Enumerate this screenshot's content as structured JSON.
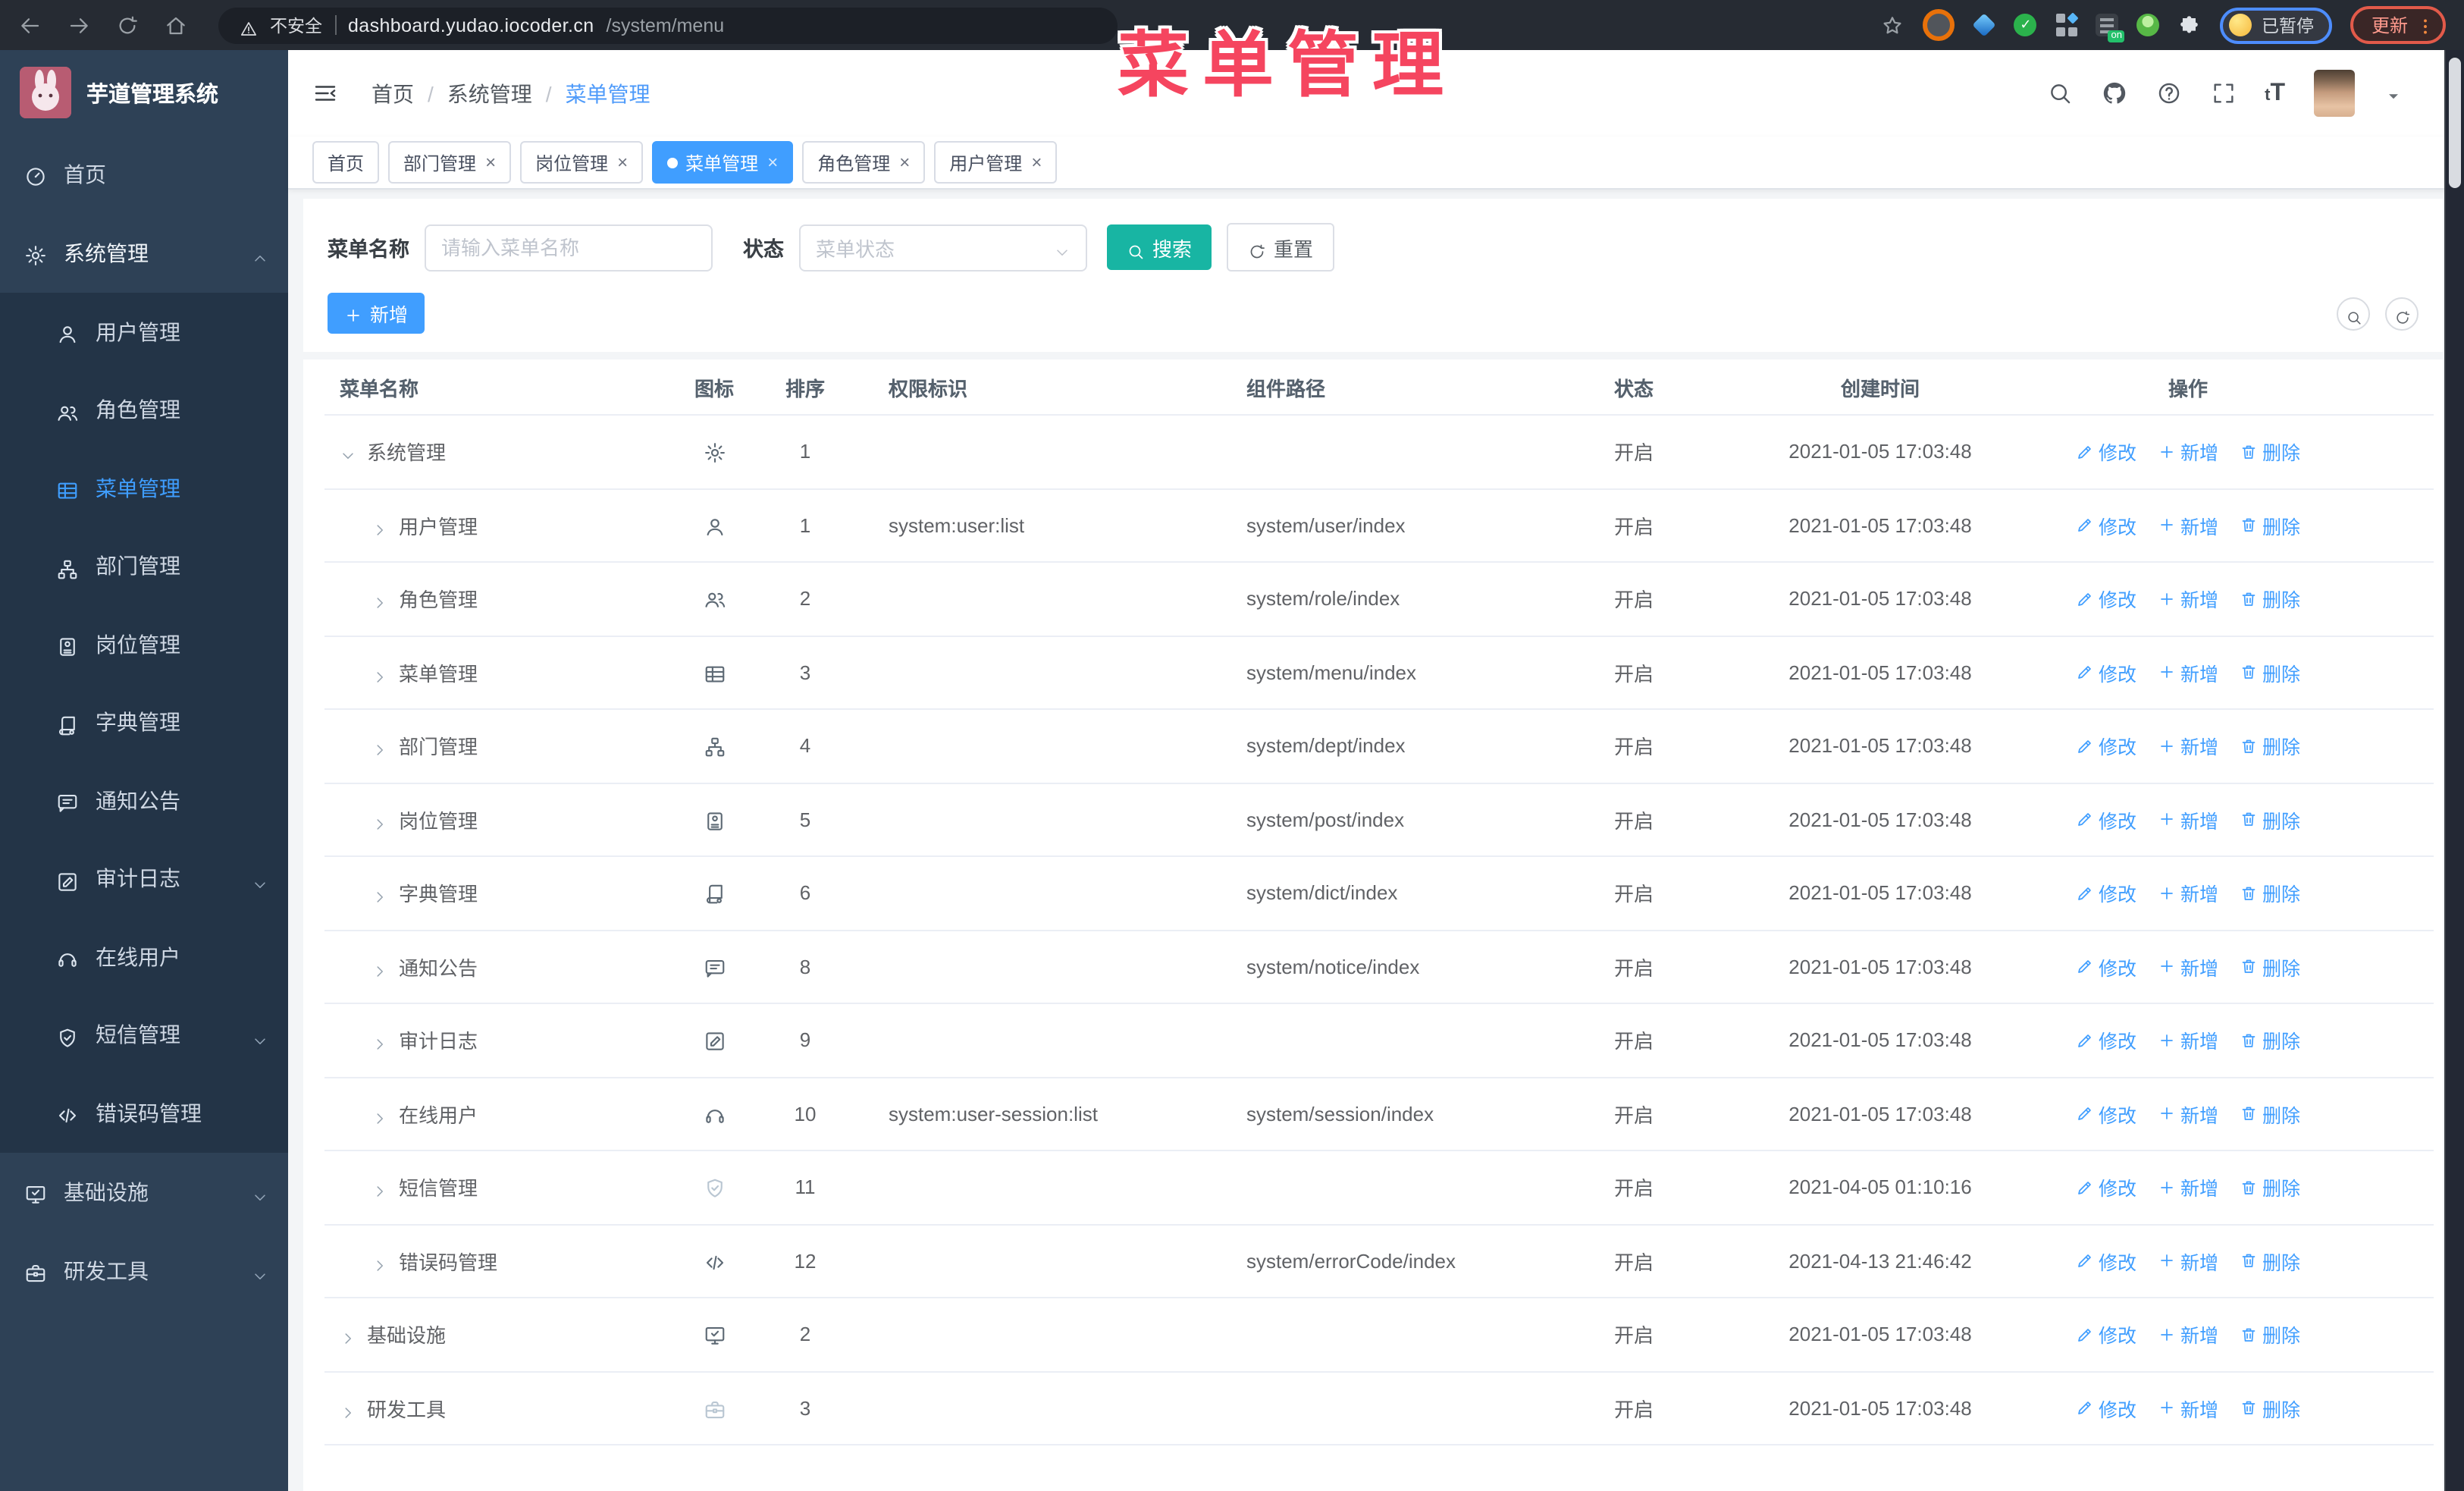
{
  "browser": {
    "security_label": "不安全",
    "url_host": "dashboard.yudao.iocoder.cn",
    "url_path": "/system/menu",
    "paused_label": "已暂停",
    "update_label": "更新"
  },
  "overlay_title": "菜单管理",
  "sidebar": {
    "logo_title": "芋道管理系统",
    "items": [
      {
        "key": "home",
        "label": "首页",
        "icon": "dashboard",
        "level": 0
      },
      {
        "key": "system",
        "label": "系统管理",
        "icon": "gear",
        "level": 0,
        "chevron": "up",
        "open": true
      },
      {
        "key": "user",
        "label": "用户管理",
        "icon": "user",
        "level": 1
      },
      {
        "key": "role",
        "label": "角色管理",
        "icon": "users",
        "level": 1
      },
      {
        "key": "menu",
        "label": "菜单管理",
        "icon": "menu",
        "level": 1,
        "active": true
      },
      {
        "key": "dept",
        "label": "部门管理",
        "icon": "tree",
        "level": 1
      },
      {
        "key": "post",
        "label": "岗位管理",
        "icon": "badge",
        "level": 1
      },
      {
        "key": "dict",
        "label": "字典管理",
        "icon": "dict",
        "level": 1
      },
      {
        "key": "notice",
        "label": "通知公告",
        "icon": "message",
        "level": 1
      },
      {
        "key": "audit",
        "label": "审计日志",
        "icon": "edit",
        "level": 1,
        "chevron": "down"
      },
      {
        "key": "online",
        "label": "在线用户",
        "icon": "headset",
        "level": 1
      },
      {
        "key": "sms",
        "label": "短信管理",
        "icon": "shield",
        "level": 1,
        "chevron": "down",
        "muted": true
      },
      {
        "key": "errcode",
        "label": "错误码管理",
        "icon": "code",
        "level": 1
      },
      {
        "key": "infra",
        "label": "基础设施",
        "icon": "monitor",
        "level": 0,
        "chevron": "down"
      },
      {
        "key": "tools",
        "label": "研发工具",
        "icon": "toolbox",
        "level": 0,
        "chevron": "down"
      }
    ]
  },
  "header": {
    "breadcrumb": [
      "首页",
      "系统管理",
      "菜单管理"
    ]
  },
  "tabs": [
    {
      "label": "首页",
      "active": false,
      "closable": false
    },
    {
      "label": "部门管理",
      "active": false,
      "closable": true
    },
    {
      "label": "岗位管理",
      "active": false,
      "closable": true
    },
    {
      "label": "菜单管理",
      "active": true,
      "closable": true
    },
    {
      "label": "角色管理",
      "active": false,
      "closable": true
    },
    {
      "label": "用户管理",
      "active": false,
      "closable": true
    }
  ],
  "filter": {
    "name_label": "菜单名称",
    "name_placeholder": "请输入菜单名称",
    "status_label": "状态",
    "status_placeholder": "菜单状态",
    "search_label": "搜索",
    "reset_label": "重置"
  },
  "toolbar": {
    "add_label": "新增"
  },
  "table": {
    "columns": [
      "菜单名称",
      "图标",
      "排序",
      "权限标识",
      "组件路径",
      "状态",
      "创建时间",
      "操作"
    ],
    "rows": [
      {
        "name": "系统管理",
        "icon": "gear",
        "level": 0,
        "expanded": true,
        "sort": "1",
        "perm": "",
        "path": "",
        "status": "开启",
        "time": "2021-01-05 17:03:48"
      },
      {
        "name": "用户管理",
        "icon": "user",
        "level": 1,
        "sort": "1",
        "perm": "system:user:list",
        "path": "system/user/index",
        "status": "开启",
        "time": "2021-01-05 17:03:48"
      },
      {
        "name": "角色管理",
        "icon": "users",
        "level": 1,
        "sort": "2",
        "perm": "",
        "path": "system/role/index",
        "status": "开启",
        "time": "2021-01-05 17:03:48"
      },
      {
        "name": "菜单管理",
        "icon": "menu",
        "level": 1,
        "sort": "3",
        "perm": "",
        "path": "system/menu/index",
        "status": "开启",
        "time": "2021-01-05 17:03:48"
      },
      {
        "name": "部门管理",
        "icon": "tree",
        "level": 1,
        "sort": "4",
        "perm": "",
        "path": "system/dept/index",
        "status": "开启",
        "time": "2021-01-05 17:03:48"
      },
      {
        "name": "岗位管理",
        "icon": "badge",
        "level": 1,
        "sort": "5",
        "perm": "",
        "path": "system/post/index",
        "status": "开启",
        "time": "2021-01-05 17:03:48"
      },
      {
        "name": "字典管理",
        "icon": "dict",
        "level": 1,
        "sort": "6",
        "perm": "",
        "path": "system/dict/index",
        "status": "开启",
        "time": "2021-01-05 17:03:48"
      },
      {
        "name": "通知公告",
        "icon": "message",
        "level": 1,
        "sort": "8",
        "perm": "",
        "path": "system/notice/index",
        "status": "开启",
        "time": "2021-01-05 17:03:48"
      },
      {
        "name": "审计日志",
        "icon": "edit",
        "level": 1,
        "sort": "9",
        "perm": "",
        "path": "",
        "status": "开启",
        "time": "2021-01-05 17:03:48"
      },
      {
        "name": "在线用户",
        "icon": "headset",
        "level": 1,
        "sort": "10",
        "perm": "system:user-session:list",
        "path": "system/session/index",
        "status": "开启",
        "time": "2021-01-05 17:03:48"
      },
      {
        "name": "短信管理",
        "icon": "shield",
        "level": 1,
        "muted": true,
        "sort": "11",
        "perm": "",
        "path": "",
        "status": "开启",
        "time": "2021-04-05 01:10:16"
      },
      {
        "name": "错误码管理",
        "icon": "code",
        "level": 1,
        "sort": "12",
        "perm": "",
        "path": "system/errorCode/index",
        "status": "开启",
        "time": "2021-04-13 21:46:42"
      },
      {
        "name": "基础设施",
        "icon": "monitor",
        "level": 0,
        "expanded": false,
        "sort": "2",
        "perm": "",
        "path": "",
        "status": "开启",
        "time": "2021-01-05 17:03:48"
      },
      {
        "name": "研发工具",
        "icon": "toolbox",
        "level": 0,
        "expanded": false,
        "muted": true,
        "sort": "3",
        "perm": "",
        "path": "",
        "status": "开启",
        "time": "2021-01-05 17:03:48"
      }
    ]
  },
  "row_actions": {
    "edit": "修改",
    "add": "新增",
    "delete": "删除"
  },
  "colors": {
    "primary": "#409eff",
    "teal": "#18b5a3",
    "overlay_red": "#f5455f",
    "sidebar_bg": "#2e4156",
    "submenu_bg": "#233447",
    "browser_bar": "#262b33"
  }
}
